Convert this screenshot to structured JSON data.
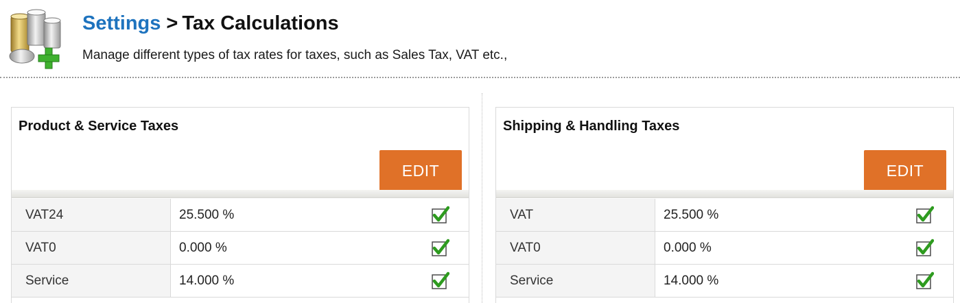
{
  "header": {
    "breadcrumb_link": "Settings",
    "breadcrumb_separator": ">",
    "title": "Tax Calculations",
    "subtitle": "Manage different types of tax rates for taxes, such as Sales Tax, VAT etc.,",
    "logo_icon": "coins-add-icon"
  },
  "panels": [
    {
      "title": "Product & Service Taxes",
      "edit_label": "EDIT",
      "rows": [
        {
          "name": "VAT24",
          "rate": "25.500 %",
          "enabled_icon": "checkmark-icon"
        },
        {
          "name": "VAT0",
          "rate": "0.000 %",
          "enabled_icon": "checkmark-icon"
        },
        {
          "name": "Service",
          "rate": "14.000 %",
          "enabled_icon": "checkmark-icon"
        }
      ]
    },
    {
      "title": "Shipping & Handling Taxes",
      "edit_label": "EDIT",
      "rows": [
        {
          "name": "VAT",
          "rate": "25.500 %",
          "enabled_icon": "checkmark-icon"
        },
        {
          "name": "VAT0",
          "rate": "0.000 %",
          "enabled_icon": "checkmark-icon"
        },
        {
          "name": "Service",
          "rate": "14.000 %",
          "enabled_icon": "checkmark-icon"
        }
      ]
    }
  ],
  "colors": {
    "link": "#1e73be",
    "edit_button": "#e07128",
    "check": "#2e9b1f"
  }
}
